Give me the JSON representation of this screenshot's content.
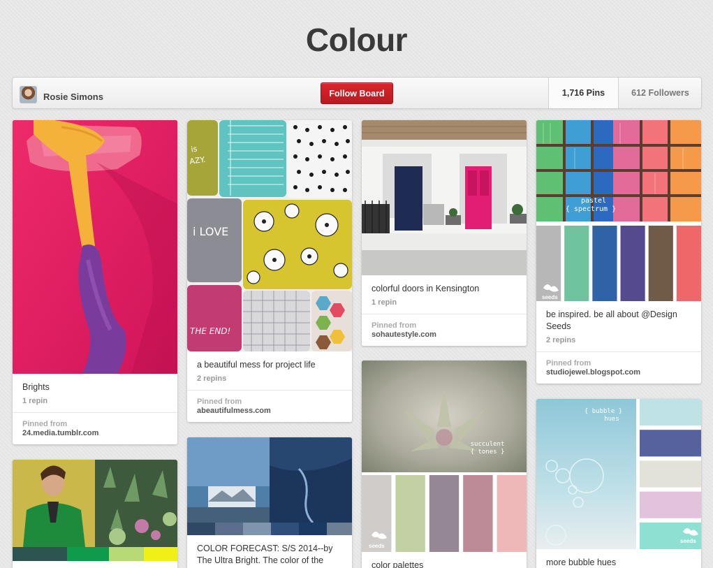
{
  "board": {
    "title": "Colour",
    "owner_name": "Rosie Simons",
    "follow_label": "Follow Board",
    "pins_count": "1,716 Pins",
    "followers_count": "612 Followers"
  },
  "pins": [
    {
      "desc": "Brights",
      "repins": "1 repin",
      "pinned_from_label": "Pinned from",
      "source": "24.media.tumblr.com"
    },
    {
      "desc": "a beautiful mess for project life",
      "repins": "2 repins",
      "pinned_from_label": "Pinned from",
      "source": "abeautifulmess.com"
    },
    {
      "desc": "colorful doors in Kensington",
      "repins": "1 repin",
      "pinned_from_label": "Pinned from",
      "source": "sohautestyle.com"
    },
    {
      "desc": "be inspired. be all about @Design Seeds",
      "repins": "2 repins",
      "pinned_from_label": "Pinned from",
      "source": "studiojewel.blogspot.com"
    },
    {
      "desc": "COLOR FORECAST: S/S 2014--by The Ultra Bright. The color of the"
    },
    {
      "desc": "color palettes"
    },
    {
      "desc": "more bubble hues"
    }
  ],
  "image_text": {
    "pastel_spectrum": [
      "pastel",
      "{ spectrum }"
    ],
    "succulent_tones": [
      "succulent",
      "{ tones }"
    ],
    "bubble_hues": [
      "{ bubble }",
      "hues"
    ],
    "i_love": "i LOVE",
    "the_end": "THE END!",
    "seeds": "seeds"
  },
  "colors": {
    "follow_button": "#c4202a",
    "pastel_palette": [
      "#b7b7b7",
      "#6fc39e",
      "#2f63a8",
      "#564a8e",
      "#6f5b47",
      "#f0676a"
    ],
    "succulent_palette": [
      "#cfccca",
      "#c2d0a3",
      "#958793",
      "#bd8a97",
      "#efb8b8"
    ],
    "bubble_palette": [
      "#bfe2e6",
      "#56629c",
      "#e3e2d8",
      "#e3c2de",
      "#8ee0d2"
    ]
  }
}
